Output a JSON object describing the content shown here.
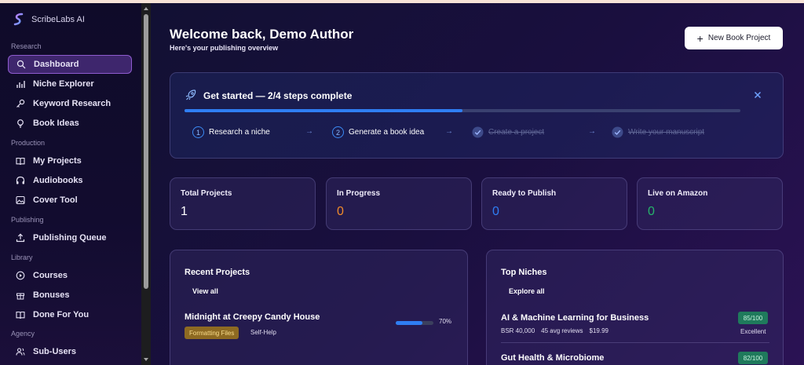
{
  "app": {
    "name": "ScribeLabs AI"
  },
  "sidebar": {
    "sections": {
      "research": "Research",
      "production": "Production",
      "publishing": "Publishing",
      "library": "Library",
      "agency": "Agency"
    },
    "items": {
      "dashboard": "Dashboard",
      "niche_explorer": "Niche Explorer",
      "keyword_research": "Keyword Research",
      "book_ideas": "Book Ideas",
      "my_projects": "My Projects",
      "audiobooks": "Audiobooks",
      "cover_tool": "Cover Tool",
      "publishing_queue": "Publishing Queue",
      "courses": "Courses",
      "bonuses": "Bonuses",
      "done_for_you": "Done For You",
      "sub_users": "Sub-Users"
    },
    "active": "dashboard"
  },
  "header": {
    "title": "Welcome back, Demo Author",
    "subtitle": "Here's your publishing overview",
    "new_project_label": "New Book Project"
  },
  "get_started": {
    "title": "Get started — 2/4 steps complete",
    "progress_fraction": 0.5,
    "steps": [
      {
        "num": "1",
        "label": "Research a niche",
        "done": false
      },
      {
        "num": "2",
        "label": "Generate a book idea",
        "done": false
      },
      {
        "num": "",
        "label": "Create a project",
        "done": true
      },
      {
        "num": "",
        "label": "Write your manuscript",
        "done": true
      }
    ]
  },
  "stats": [
    {
      "label": "Total Projects",
      "value": "1",
      "color": "#ffffff"
    },
    {
      "label": "In Progress",
      "value": "0",
      "color": "#f08a2a"
    },
    {
      "label": "Ready to Publish",
      "value": "0",
      "color": "#2f7ef3"
    },
    {
      "label": "Live on Amazon",
      "value": "0",
      "color": "#26b36b"
    }
  ],
  "recent_projects": {
    "title": "Recent Projects",
    "view_all": "View all",
    "items": [
      {
        "title": "Midnight at Creepy Candy House",
        "status": "Formatting Files",
        "genre": "Self-Help",
        "progress": "70%",
        "progress_fraction": 0.7
      }
    ]
  },
  "top_niches": {
    "title": "Top Niches",
    "explore_all": "Explore all",
    "items": [
      {
        "name": "AI & Machine Learning for Business",
        "bsr": "BSR 40,000",
        "reviews": "45 avg reviews",
        "price": "$19.99",
        "score": "85/100",
        "rating": "Excellent"
      },
      {
        "name": "Gut Health & Microbiome",
        "score": "82/100"
      }
    ]
  },
  "colors": {
    "accent": "#2f7ef3",
    "badge_gold": "#8e6a22",
    "badge_green": "#1f7a5c"
  }
}
